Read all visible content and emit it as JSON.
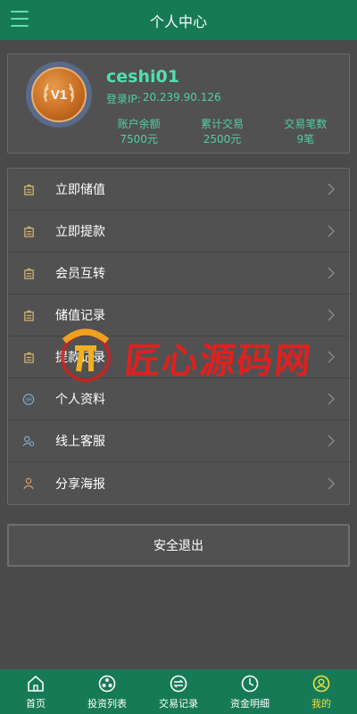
{
  "header": {
    "title": "个人中心"
  },
  "profile": {
    "level_badge": "V1",
    "username": "ceshi01",
    "login_ip_label": "登录IP:",
    "login_ip": "20.239.90.126",
    "stats": [
      {
        "label": "账户余额",
        "value": "7500元"
      },
      {
        "label": "累计交易",
        "value": "2500元"
      },
      {
        "label": "交易笔数",
        "value": "9笔"
      }
    ]
  },
  "menu": {
    "items": [
      {
        "label": "立即储值",
        "icon": "wallet-icon"
      },
      {
        "label": "立即提款",
        "icon": "wallet-icon"
      },
      {
        "label": "会员互转",
        "icon": "wallet-icon"
      },
      {
        "label": "储值记录",
        "icon": "wallet-icon"
      },
      {
        "label": "提款记录",
        "icon": "wallet-icon"
      },
      {
        "label": "个人资料",
        "icon": "profile-badge-icon"
      },
      {
        "label": "线上客服",
        "icon": "customer-service-icon"
      },
      {
        "label": "分享海报",
        "icon": "share-user-icon"
      }
    ]
  },
  "logout_label": "安全退出",
  "watermark": {
    "text": "匠心源码网"
  },
  "tabs": [
    {
      "label": "首页",
      "icon": "home-icon",
      "active": false
    },
    {
      "label": "投资列表",
      "icon": "invest-list-icon",
      "active": false
    },
    {
      "label": "交易记录",
      "icon": "exchange-icon",
      "active": false
    },
    {
      "label": "资金明细",
      "icon": "clock-icon",
      "active": false
    },
    {
      "label": "我的",
      "icon": "user-icon",
      "active": true
    }
  ],
  "colors": {
    "header_bg": "#167a56",
    "accent_text": "#4fd0a0",
    "active_tab": "#f0e040",
    "page_bg": "#4a4a4a"
  }
}
